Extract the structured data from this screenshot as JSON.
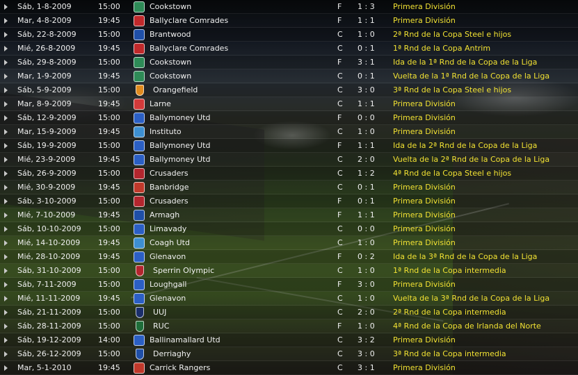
{
  "fixtures": [
    {
      "date": "Sáb, 1-8-2009",
      "time": "15:00",
      "team": "Cookstown",
      "venue": "F",
      "score": "1 : 3",
      "competition": "Primera División",
      "badge_color": "#2e8b57"
    },
    {
      "date": "Mar, 4-8-2009",
      "time": "19:45",
      "team": "Ballyclare Comrades",
      "venue": "F",
      "score": "1 : 1",
      "competition": "Primera División",
      "badge_color": "#c0292b"
    },
    {
      "date": "Sáb, 22-8-2009",
      "time": "15:00",
      "team": "Brantwood",
      "venue": "C",
      "score": "1 : 0",
      "competition": "2ª Rnd de la Copa Steel e hijos",
      "badge_color": "#1f4fa8"
    },
    {
      "date": "Mié, 26-8-2009",
      "time": "19:45",
      "team": "Ballyclare Comrades",
      "venue": "C",
      "score": "0 : 1",
      "competition": "1ª Rnd de la Copa Antrim",
      "badge_color": "#c0292b"
    },
    {
      "date": "Sáb, 29-8-2009",
      "time": "15:00",
      "team": "Cookstown",
      "venue": "F",
      "score": "3 : 1",
      "competition": "Ida de la 1ª Rnd de la Copa de la Liga",
      "badge_color": "#2e8b57"
    },
    {
      "date": "Mar, 1-9-2009",
      "time": "19:45",
      "team": "Cookstown",
      "venue": "C",
      "score": "0 : 1",
      "competition": "Vuelta de la 1ª Rnd de la Copa de la Liga",
      "badge_color": "#2e8b57"
    },
    {
      "date": "Sáb, 5-9-2009",
      "time": "15:00",
      "team": "Orangefield",
      "venue": "C",
      "score": "3 : 0",
      "competition": "3ª Rnd de la Copa Steel e hijos",
      "badge_color": "#e08a1e"
    },
    {
      "date": "Mar, 8-9-2009",
      "time": "19:45",
      "team": "Larne",
      "venue": "C",
      "score": "1 : 1",
      "competition": "Primera División",
      "badge_color": "#d23a3a"
    },
    {
      "date": "Sáb, 12-9-2009",
      "time": "15:00",
      "team": "Ballymoney Utd",
      "venue": "F",
      "score": "0 : 0",
      "competition": "Primera División",
      "badge_color": "#2b5fc4"
    },
    {
      "date": "Mar, 15-9-2009",
      "time": "19:45",
      "team": "Instituto",
      "venue": "C",
      "score": "1 : 0",
      "competition": "Primera División",
      "badge_color": "#3d8fd1"
    },
    {
      "date": "Sáb, 19-9-2009",
      "time": "15:00",
      "team": "Ballymoney Utd",
      "venue": "F",
      "score": "1 : 1",
      "competition": "Ida de la 2ª Rnd de la Copa de la Liga",
      "badge_color": "#2b5fc4"
    },
    {
      "date": "Mié, 23-9-2009",
      "time": "19:45",
      "team": "Ballymoney Utd",
      "venue": "C",
      "score": "2 : 0",
      "competition": "Vuelta de la 2ª Rnd de la Copa de la Liga",
      "badge_color": "#2b5fc4"
    },
    {
      "date": "Sáb, 26-9-2009",
      "time": "15:00",
      "team": "Crusaders",
      "venue": "C",
      "score": "1 : 2",
      "competition": "4ª Rnd de la Copa Steel e hijos",
      "badge_color": "#b3262e"
    },
    {
      "date": "Mié, 30-9-2009",
      "time": "19:45",
      "team": "Banbridge",
      "venue": "C",
      "score": "0 : 1",
      "competition": "Primera División",
      "badge_color": "#c0392b"
    },
    {
      "date": "Sáb, 3-10-2009",
      "time": "15:00",
      "team": "Crusaders",
      "venue": "F",
      "score": "0 : 1",
      "competition": "Primera División",
      "badge_color": "#b3262e"
    },
    {
      "date": "Mié, 7-10-2009",
      "time": "19:45",
      "team": "Armagh",
      "venue": "F",
      "score": "1 : 1",
      "competition": "Primera División",
      "badge_color": "#1f4fa8"
    },
    {
      "date": "Sáb, 10-10-2009",
      "time": "15:00",
      "team": "Limavady",
      "venue": "C",
      "score": "0 : 0",
      "competition": "Primera División",
      "badge_color": "#2b5fc4"
    },
    {
      "date": "Mié, 14-10-2009",
      "time": "19:45",
      "team": "Coagh Utd",
      "venue": "C",
      "score": "1 : 0",
      "competition": "Primera División",
      "badge_color": "#3d8fd1"
    },
    {
      "date": "Mié, 28-10-2009",
      "time": "19:45",
      "team": "Glenavon",
      "venue": "F",
      "score": "0 : 2",
      "competition": "Ida de la 3ª Rnd de la Copa de la Liga",
      "badge_color": "#2b5fc4"
    },
    {
      "date": "Sáb, 31-10-2009",
      "time": "15:00",
      "team": "Sperrin Olympic",
      "venue": "C",
      "score": "1 : 0",
      "competition": "1ª Rnd de la Copa intermedia",
      "badge_color": "#b3262e"
    },
    {
      "date": "Sáb, 7-11-2009",
      "time": "15:00",
      "team": "Loughgall",
      "venue": "F",
      "score": "3 : 0",
      "competition": "Primera División",
      "badge_color": "#2b5fc4"
    },
    {
      "date": "Mié, 11-11-2009",
      "time": "19:45",
      "team": "Glenavon",
      "venue": "C",
      "score": "1 : 0",
      "competition": "Vuelta de la 3ª Rnd de la Copa de la Liga",
      "badge_color": "#2b5fc4"
    },
    {
      "date": "Sáb, 21-11-2009",
      "time": "15:00",
      "team": "UUJ",
      "venue": "C",
      "score": "2 : 0",
      "competition": "2ª Rnd de la Copa intermedia",
      "badge_color": "#1b2f6b"
    },
    {
      "date": "Sáb, 28-11-2009",
      "time": "15:00",
      "team": "RUC",
      "venue": "F",
      "score": "1 : 0",
      "competition": "4ª Rnd de la Copa de Irlanda del Norte",
      "badge_color": "#1f6e3a"
    },
    {
      "date": "Sáb, 19-12-2009",
      "time": "14:00",
      "team": "Ballinamallard Utd",
      "venue": "C",
      "score": "3 : 2",
      "competition": "Primera División",
      "badge_color": "#2b5fc4"
    },
    {
      "date": "Sáb, 26-12-2009",
      "time": "15:00",
      "team": "Derriaghy",
      "venue": "C",
      "score": "3 : 0",
      "competition": "3ª Rnd de la Copa intermedia",
      "badge_color": "#1f4fa8"
    },
    {
      "date": "Mar, 5-1-2010",
      "time": "19:45",
      "team": "Carrick Rangers",
      "venue": "C",
      "score": "3 : 1",
      "competition": "Primera División",
      "badge_color": "#c0392b"
    }
  ]
}
